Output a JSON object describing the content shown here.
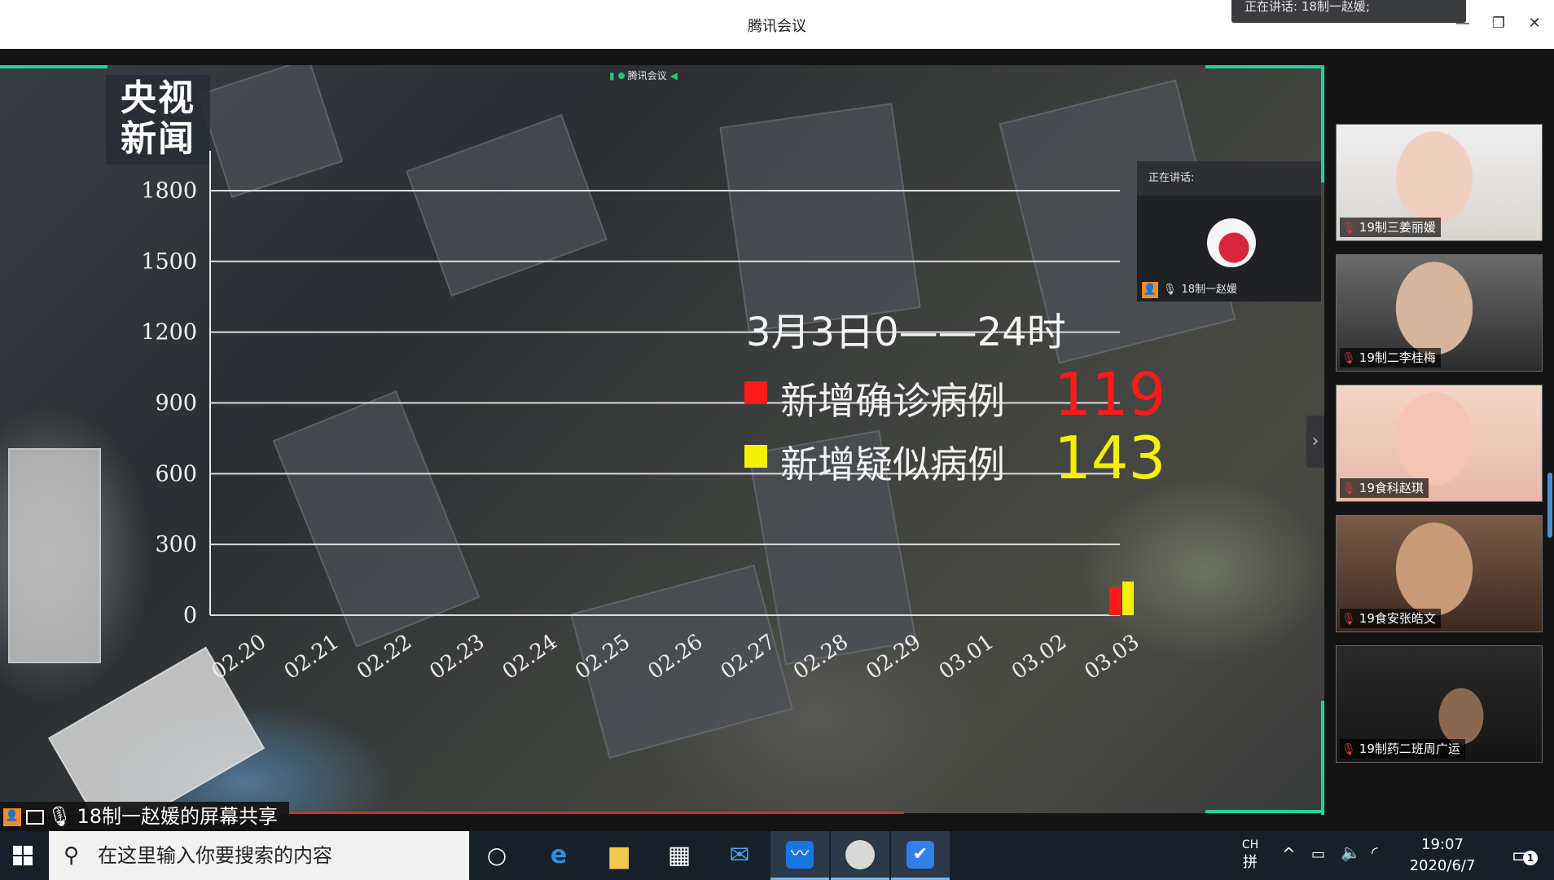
{
  "window": {
    "title": "腾讯会议",
    "speaking_toast": "正在讲话: 18制一赵媛;",
    "minimize_glyph": "—",
    "maximize_glyph": "❐",
    "close_glyph": "✕"
  },
  "share": {
    "app_tag": "腾讯会议",
    "cctv_logo_line1": "央视",
    "cctv_logo_line2": "新闻",
    "caption": "18制一赵媛的屏幕共享",
    "side_toggle_glyph": "›"
  },
  "chart_data": {
    "type": "bar",
    "title": "3月3日0——24时",
    "categories": [
      "02.20",
      "02.21",
      "02.22",
      "02.23",
      "02.24",
      "02.25",
      "02.26",
      "02.27",
      "02.28",
      "02.29",
      "03.01",
      "03.02",
      "03.03"
    ],
    "series": [
      {
        "name": "新增确诊病例",
        "color": "#ff1a1a",
        "values": [
          null,
          null,
          null,
          null,
          null,
          null,
          null,
          null,
          null,
          null,
          null,
          null,
          119
        ]
      },
      {
        "name": "新增疑似病例",
        "color": "#f4f00a",
        "values": [
          null,
          null,
          null,
          null,
          null,
          null,
          null,
          null,
          null,
          null,
          null,
          null,
          143
        ]
      }
    ],
    "yticks": [
      0,
      300,
      600,
      900,
      1200,
      1500,
      1800
    ],
    "ylim": [
      0,
      1900
    ],
    "grid": true,
    "legend_position": "center-right",
    "annotations": [
      {
        "label": "新增确诊病例",
        "value": "119",
        "color": "#ff1a1a"
      },
      {
        "label": "新增疑似病例",
        "value": "143",
        "color": "#f4f00a"
      }
    ]
  },
  "speaker_panel": {
    "heading": "正在讲话:",
    "name": "18制一赵媛"
  },
  "participants": [
    {
      "name": "19制三姜丽媛"
    },
    {
      "name": "19制二李桂梅"
    },
    {
      "name": "19食科赵琪"
    },
    {
      "name": "19食安张皓文"
    },
    {
      "name": "19制药二班周广运"
    }
  ],
  "taskbar": {
    "search_placeholder": "在这里输入你要搜索的内容",
    "ime_top": "CH",
    "ime_bottom": "拼",
    "time": "19:07",
    "date": "2020/6/7",
    "notification_count": "1",
    "icons": [
      "cortana-icon",
      "edge-icon",
      "file-explorer-icon",
      "store-icon",
      "mail-icon",
      "tencent-meeting-icon",
      "app-circle-icon",
      "shield-app-icon"
    ]
  }
}
